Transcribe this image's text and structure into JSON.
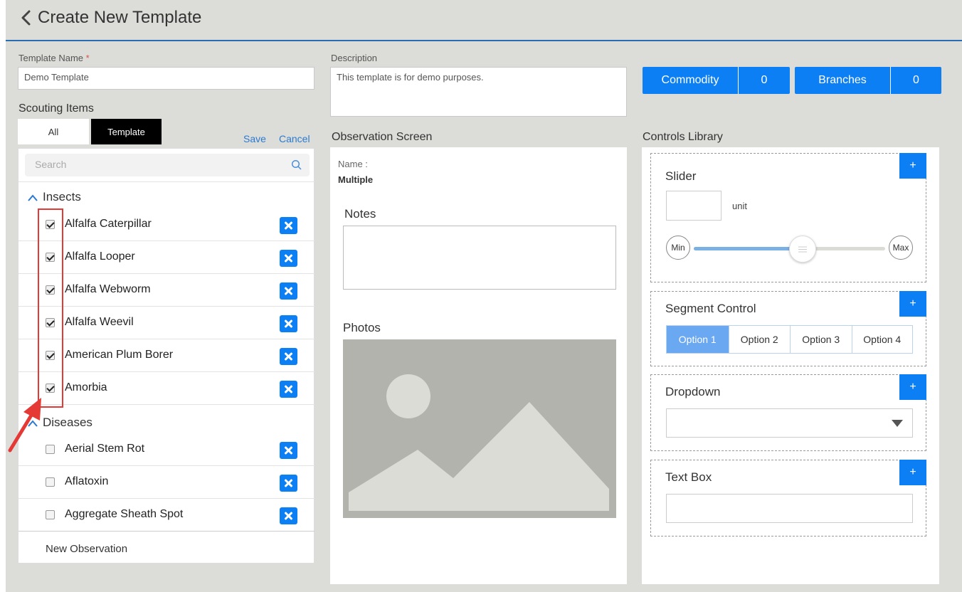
{
  "header": {
    "title": "Create New Template"
  },
  "form": {
    "template_name_label": "Template Name",
    "required_mark": "*",
    "template_name_value": "Demo Template",
    "description_label": "Description",
    "description_value": "This template is for demo purposes."
  },
  "counters": {
    "commodity_label": "Commodity",
    "commodity_count": "0",
    "branches_label": "Branches",
    "branches_count": "0"
  },
  "scouting": {
    "title": "Scouting Items",
    "tab_all": "All",
    "tab_template": "Template",
    "active_tab": "Template",
    "save": "Save",
    "cancel": "Cancel",
    "search_placeholder": "Search",
    "groups": [
      {
        "name": "Insects",
        "items": [
          {
            "label": "Alfalfa Caterpillar",
            "checked": true
          },
          {
            "label": "Alfalfa Looper",
            "checked": true
          },
          {
            "label": "Alfalfa Webworm",
            "checked": true
          },
          {
            "label": "Alfalfa Weevil",
            "checked": true
          },
          {
            "label": "American Plum Borer",
            "checked": true
          },
          {
            "label": "Amorbia",
            "checked": true
          }
        ]
      },
      {
        "name": "Diseases",
        "items": [
          {
            "label": "Aerial Stem Rot",
            "checked": false
          },
          {
            "label": "Aflatoxin",
            "checked": false
          },
          {
            "label": "Aggregate Sheath Spot",
            "checked": false
          }
        ]
      }
    ],
    "new_observation": "New Observation"
  },
  "observation": {
    "title": "Observation Screen",
    "name_label": "Name :",
    "name_value": "Multiple",
    "notes_label": "Notes",
    "photos_label": "Photos"
  },
  "controls": {
    "title": "Controls Library",
    "plus": "+",
    "slider": {
      "title": "Slider",
      "unit": "unit",
      "min": "Min",
      "max": "Max",
      "level": 0.57
    },
    "segment": {
      "title": "Segment Control",
      "options": [
        "Option 1",
        "Option 2",
        "Option 3",
        "Option 4"
      ],
      "selected": "Option 1"
    },
    "dropdown": {
      "title": "Dropdown"
    },
    "textbox": {
      "title": "Text Box"
    }
  },
  "colors": {
    "accent": "#0d7ff5",
    "header_rule": "#2b6db3",
    "background": "#dcddd8",
    "highlight": "#e53935",
    "segment_selected": "#6aa8f2"
  }
}
